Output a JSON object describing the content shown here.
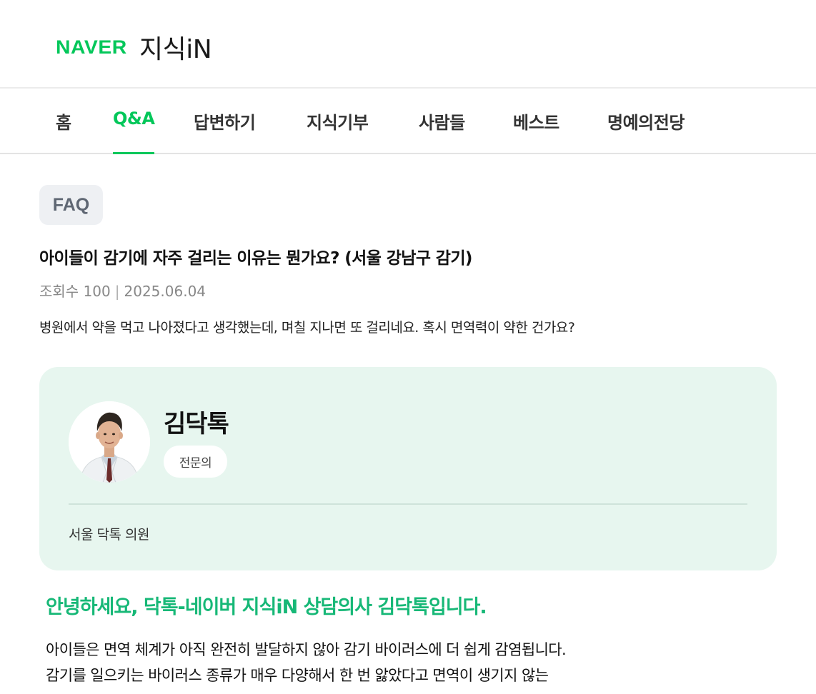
{
  "header": {
    "logo_brand": "NAVER",
    "logo_service": "지식iN",
    "brand_color": "#03c75a"
  },
  "nav": {
    "items": [
      {
        "label": "홈",
        "active": false
      },
      {
        "label": "Q&A",
        "active": true
      },
      {
        "label": "답변하기",
        "active": false
      },
      {
        "label": "지식기부",
        "active": false
      },
      {
        "label": "사람들",
        "active": false
      },
      {
        "label": "베스트",
        "active": false
      },
      {
        "label": "명예의전당",
        "active": false
      }
    ]
  },
  "question": {
    "badge": "FAQ",
    "title": "아이들이 감기에 자주 걸리는 이유는 뭔가요? (서울 강남구 감기)",
    "views_label": "조회수",
    "views": "100",
    "separator": "|",
    "date": "2025.06.04",
    "body": "병원에서 약을 먹고 나아졌다고 생각했는데, 며칠 지나면 또 걸리네요. 혹시 면역력이 약한 건가요?"
  },
  "expert": {
    "name": "김닥톡",
    "role_badge": "전문의",
    "hospital": "서울 닥톡 의원",
    "avatar_icon": "doctor-avatar",
    "card_color": "#e7f6ef"
  },
  "answer": {
    "greeting": "안녕하세요, 닥톡-네이버 지식iN 상담의사 김닥톡입니다.",
    "greeting_color": "#17b877",
    "lines": [
      "아이들은 면역 체계가 아직 완전히 발달하지 않아 감기 바이러스에 더 쉽게 감염됩니다.",
      "감기를 일으키는 바이러스 종류가 매우 다양해서 한 번 앓았다고 면역이 생기지 않는"
    ]
  }
}
